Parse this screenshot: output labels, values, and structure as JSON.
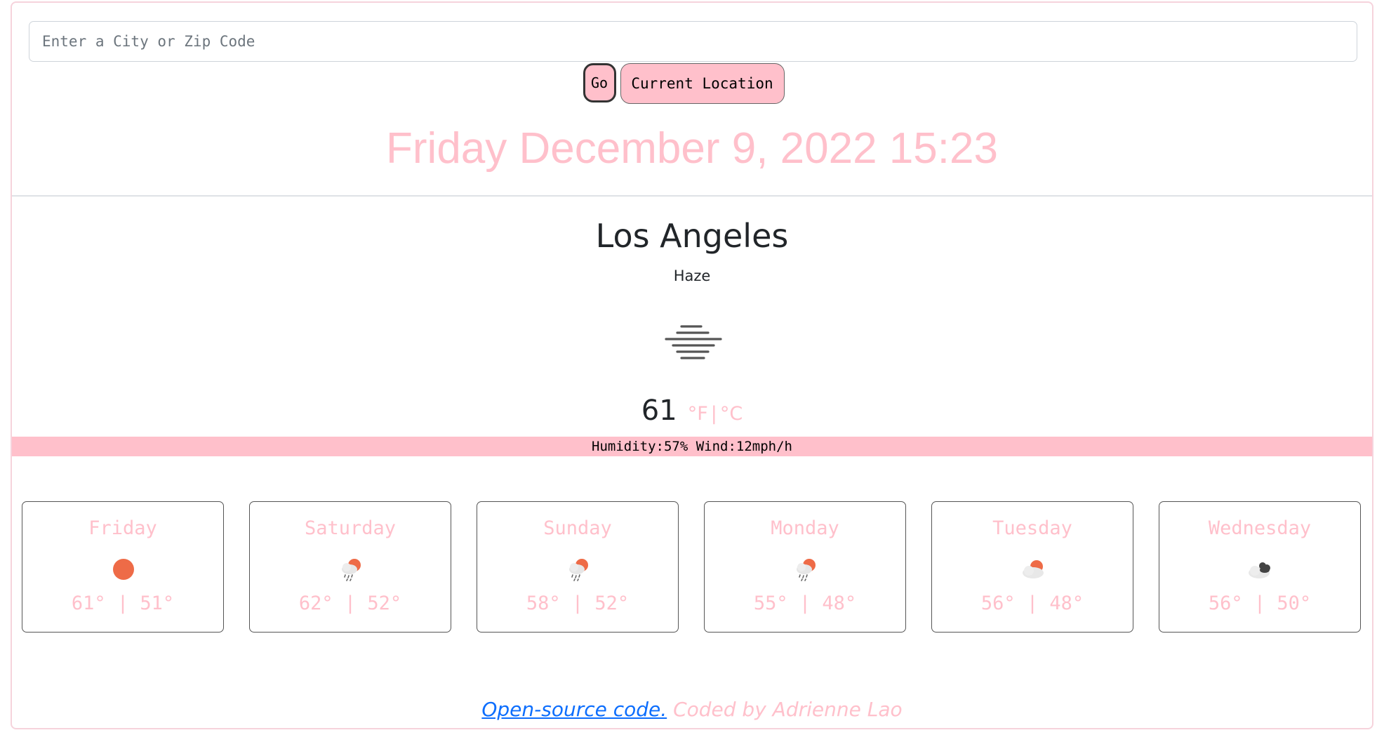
{
  "search": {
    "placeholder": "Enter a City or Zip Code",
    "value": ""
  },
  "buttons": {
    "go_label": "Go",
    "location_label": "Current Location"
  },
  "datetime": "Friday December 9, 2022 15:23",
  "current": {
    "city": "Los Angeles",
    "description": "Haze",
    "icon": "haze-icon",
    "temperature": "61",
    "unit_f": "°F",
    "unit_separator": "|",
    "unit_c": "°C",
    "stats": "Humidity:57% Wind:12mph/h"
  },
  "forecast": [
    {
      "day": "Friday",
      "icon": "sun-icon",
      "high": "61°",
      "low": "51°"
    },
    {
      "day": "Saturday",
      "icon": "rain-sun-icon",
      "high": "62°",
      "low": "52°"
    },
    {
      "day": "Sunday",
      "icon": "rain-sun-icon",
      "high": "58°",
      "low": "52°"
    },
    {
      "day": "Monday",
      "icon": "rain-sun-icon",
      "high": "55°",
      "low": "48°"
    },
    {
      "day": "Tuesday",
      "icon": "partly-cloudy-icon",
      "high": "56°",
      "low": "48°"
    },
    {
      "day": "Wednesday",
      "icon": "cloudy-icon",
      "high": "56°",
      "low": "50°"
    }
  ],
  "footer": {
    "link_text": "Open-source code.",
    "credit": "Coded by Adrienne Lao"
  },
  "colors": {
    "accent_pink": "#ffc0cb",
    "link_blue": "#0d6efd",
    "sun_orange": "#ee6b47"
  }
}
